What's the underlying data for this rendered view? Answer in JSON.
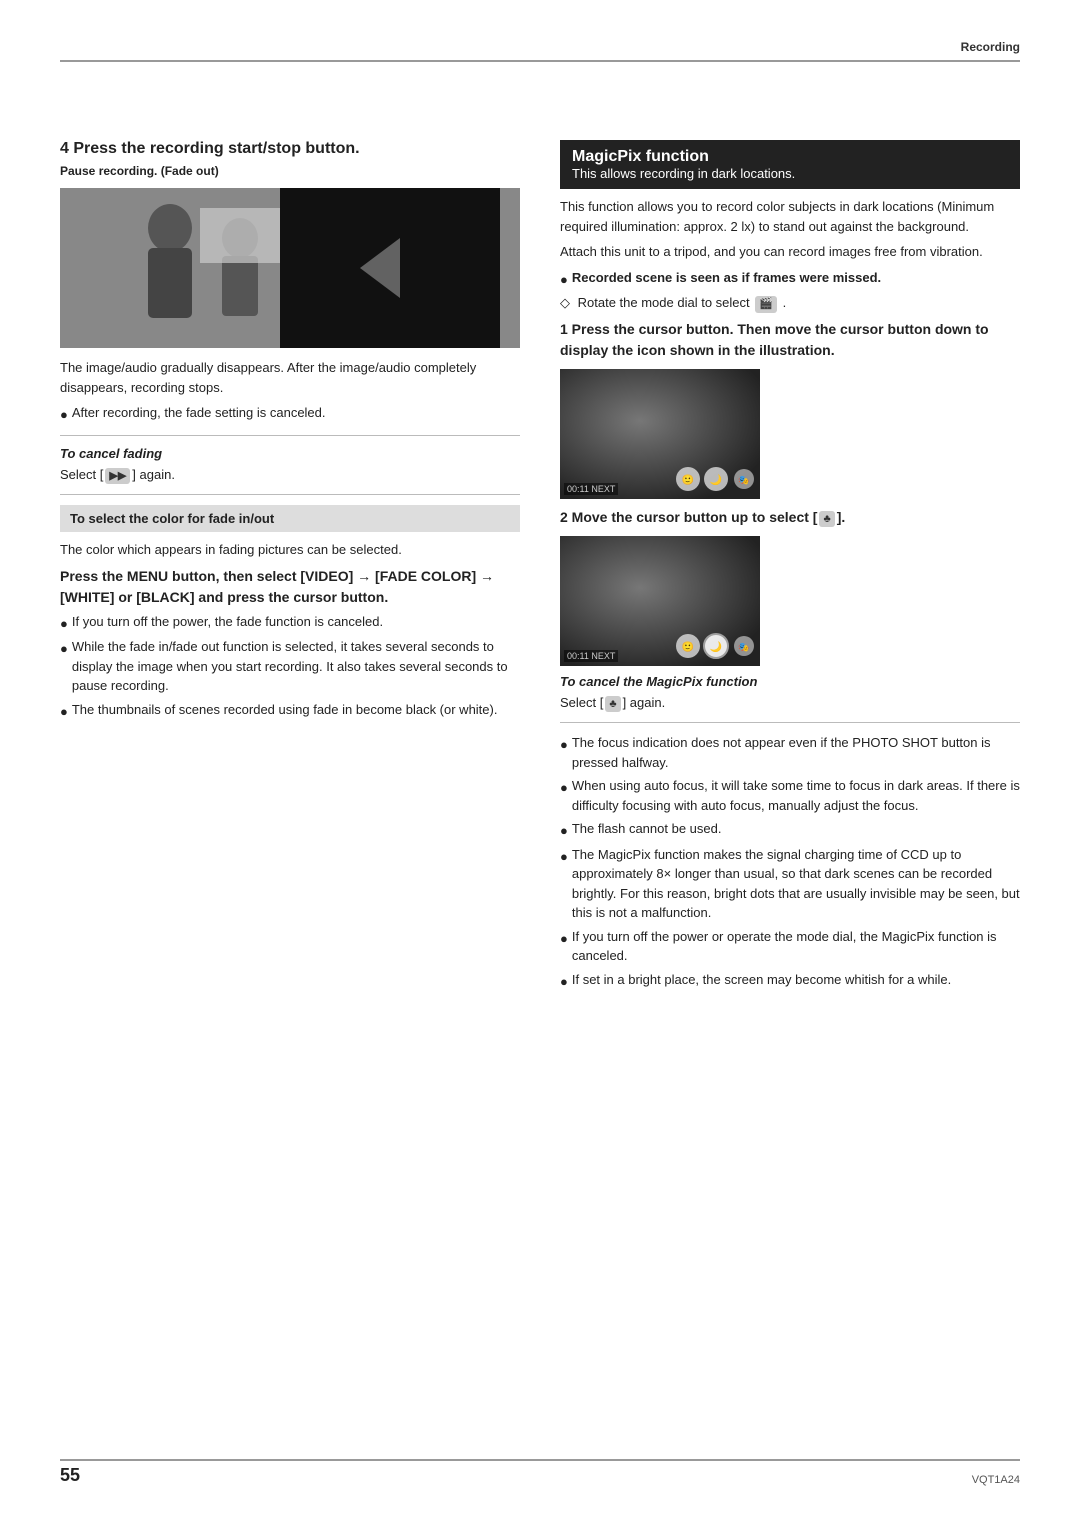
{
  "header": {
    "label": "Recording"
  },
  "left_column": {
    "section4": {
      "title": "4  Press the recording start/stop button.",
      "pause_label": "Pause recording. (Fade out)",
      "description": "The image/audio gradually disappears. After the image/audio completely disappears, recording stops.",
      "bullet1": "After recording, the fade setting is canceled.",
      "cancel_heading": "To cancel fading",
      "cancel_text": "Select [",
      "cancel_icon": "▶",
      "cancel_text2": "] again."
    },
    "select_color": {
      "box_label": "To select the color for fade in/out",
      "description": "The color which appears in fading pictures can be selected."
    },
    "menu_section": {
      "heading": "Press the MENU button, then select [VIDEO] → [FADE COLOR] → [WHITE] or [BLACK] and press the cursor button.",
      "bullet1": "If you turn off the power, the fade function is canceled.",
      "bullet2": "While the fade in/fade out function is selected, it takes several seconds to display the image when you start recording. It also takes several seconds to pause recording.",
      "bullet3": "The thumbnails of scenes recorded using fade in become black (or white)."
    }
  },
  "right_column": {
    "magicpix": {
      "box_main_title": "MagicPix function",
      "box_sub_title": "This allows recording in dark locations.",
      "description1": "This function allows you to record color subjects in dark locations (Minimum required illumination: approx. 2 lx) to stand out against the background.",
      "description2": "Attach this unit to a tripod, and you can record images free from vibration.",
      "bullet1": "Recorded scene is seen as if frames were missed.",
      "rotate_text": "Rotate the mode dial to select",
      "rotate_icon": "🎬",
      "step1_heading": "1  Press the cursor button. Then move the cursor button down to display the icon shown in the illustration.",
      "step2_heading": "2  Move the cursor button up to select [",
      "step2_icon": "♣",
      "step2_end": "].",
      "cancel_magicpix_heading": "To cancel the MagicPix function",
      "cancel_text": "Select [",
      "cancel_icon": "♣",
      "cancel_text2": "] again.",
      "bullet_notes": [
        "The focus indication does not appear even if the PHOTO SHOT button is pressed halfway.",
        "When using auto focus, it will take some time to focus in dark areas. If there is difficulty focusing with auto focus, manually adjust the focus.",
        "The flash cannot be used.",
        "The MagicPix function makes the signal charging time of CCD up to approximately 8× longer than usual, so that dark scenes can be recorded brightly. For this reason, bright dots that are usually invisible may be seen, but this is not a malfunction.",
        "If you turn off the power or operate the mode dial, the MagicPix function is canceled.",
        "If set in a bright place, the screen may become whitish for a while."
      ]
    }
  },
  "footer": {
    "page_number": "55",
    "doc_code": "VQT1A24"
  }
}
